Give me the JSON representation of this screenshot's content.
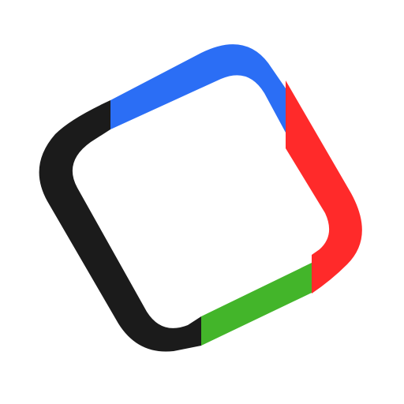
{
  "logo": {
    "icon": "rotated-rounded-square-frame-icon",
    "colors": {
      "background": "#ffffff",
      "black": "#1b1b1b",
      "blue": "#2b6ef5",
      "red": "#ff2a2a",
      "green": "#43b52a"
    }
  }
}
